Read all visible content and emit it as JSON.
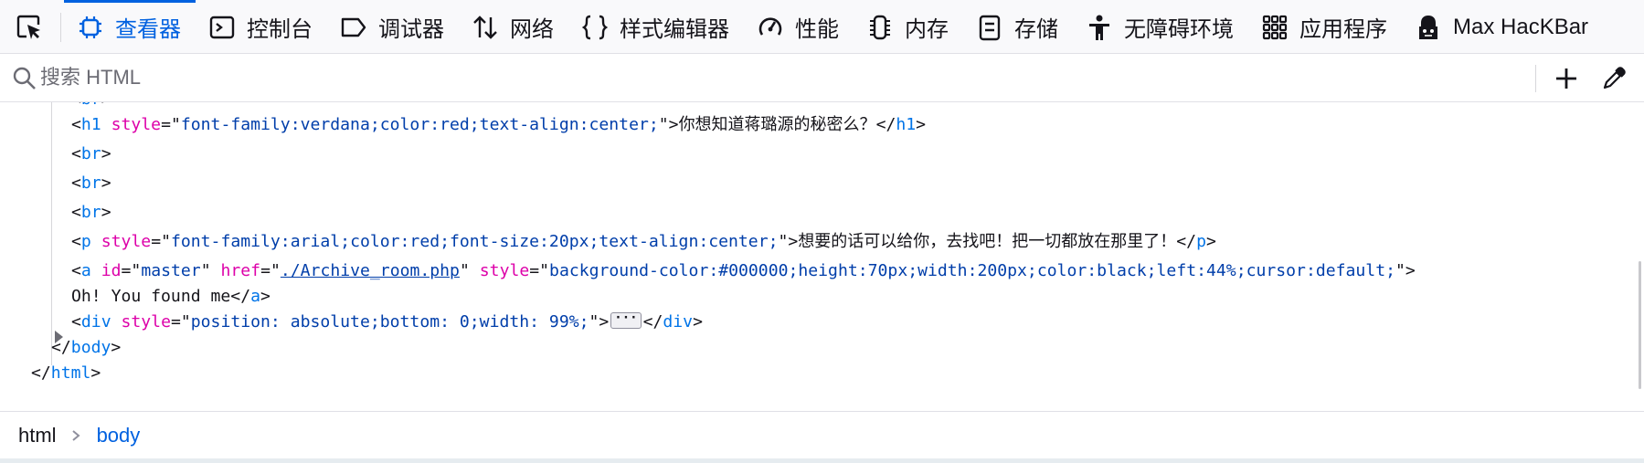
{
  "toolbar": {
    "tabs": [
      {
        "label": "查看器",
        "icon": "inspector-icon"
      },
      {
        "label": "控制台",
        "icon": "console-icon"
      },
      {
        "label": "调试器",
        "icon": "debugger-icon"
      },
      {
        "label": "网络",
        "icon": "network-icon"
      },
      {
        "label": "样式编辑器",
        "icon": "style-editor-icon"
      },
      {
        "label": "性能",
        "icon": "performance-icon"
      },
      {
        "label": "内存",
        "icon": "memory-icon"
      },
      {
        "label": "存储",
        "icon": "storage-icon"
      },
      {
        "label": "无障碍环境",
        "icon": "accessibility-icon"
      },
      {
        "label": "应用程序",
        "icon": "application-icon"
      },
      {
        "label": "Max HacKBar",
        "icon": "hackbar-icon"
      }
    ],
    "active_tab": "查看器",
    "accent_color": "#0061e0"
  },
  "search": {
    "placeholder": "搜索 HTML",
    "value": ""
  },
  "markup": {
    "lines": {
      "br": "br",
      "h1_tag": "h1",
      "h1_style_attr": "style",
      "h1_style_val": "font-family:verdana;color:red;text-align:center;",
      "h1_text": "你想知道蒋璐源的秘密么？",
      "p_tag": "p",
      "p_style_attr": "style",
      "p_style_val": "font-family:arial;color:red;font-size:20px;text-align:center;",
      "p_text": "想要的话可以给你，去找吧！把一切都放在那里了！",
      "a_tag": "a",
      "a_id_attr": "id",
      "a_id_val": "master",
      "a_href_attr": "href",
      "a_href_val": "./Archive_room.php",
      "a_style_attr": "style",
      "a_style_val": "background-color:#000000;height:70px;width:200px;color:black;left:44%;cursor:default;",
      "a_text": "Oh! You found me",
      "div_tag": "div",
      "div_style_attr": "style",
      "div_style_val": "position: absolute;bottom: 0;width: 99%;",
      "body_tag": "body",
      "html_tag": "html"
    }
  },
  "breadcrumbs": {
    "items": [
      "html",
      "body"
    ],
    "selected": "body"
  },
  "colors": {
    "tag": "#0074e8",
    "attribute": "#dd00a9",
    "attribute_value": "#003eaa"
  }
}
